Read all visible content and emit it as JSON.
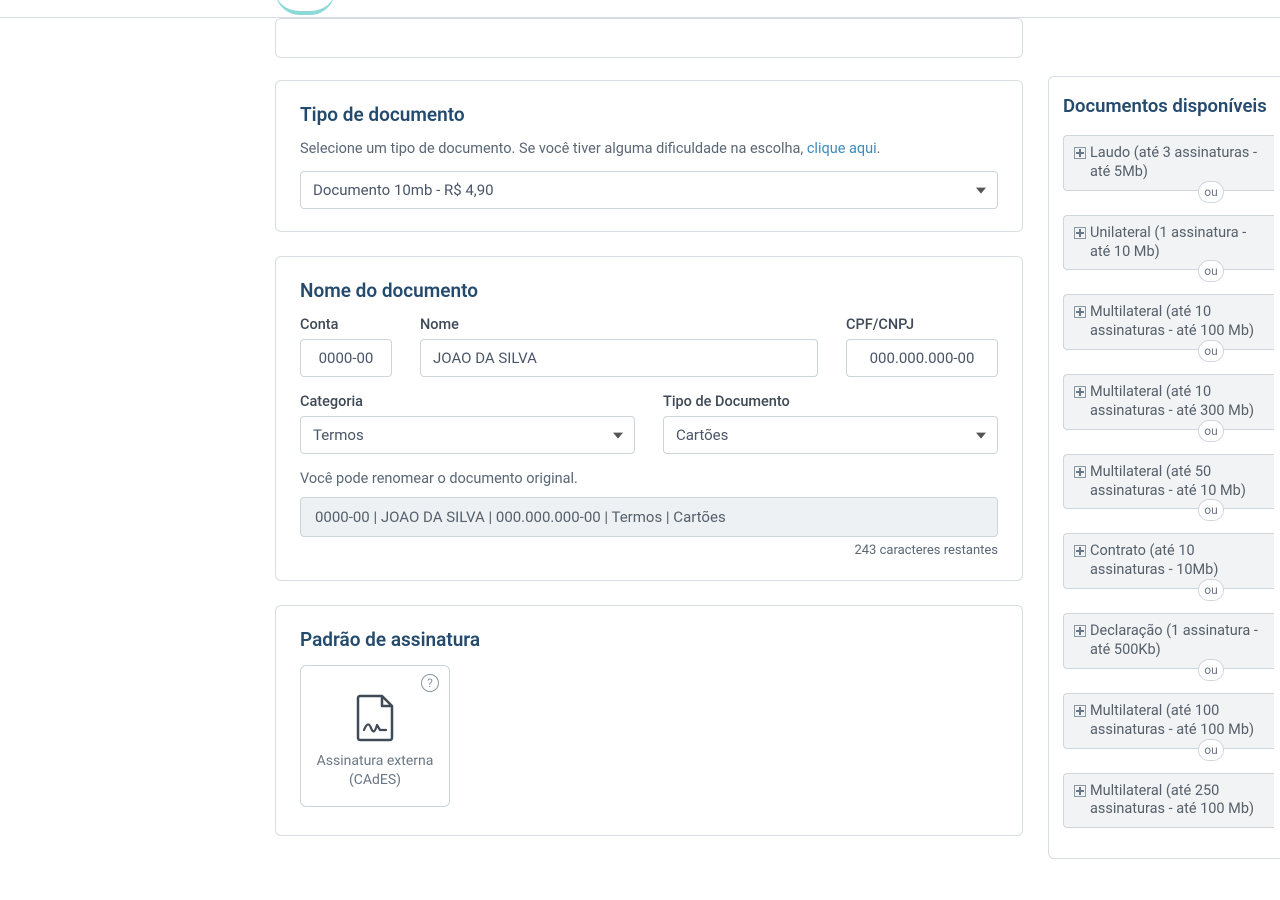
{
  "tipo_documento": {
    "title": "Tipo de documento",
    "helper_prefix": "Selecione um tipo de documento. Se você tiver alguma dificuldade na escolha, ",
    "helper_link": "clique aqui",
    "helper_suffix": ".",
    "selected": "Documento 10mb - R$ 4,90"
  },
  "nome_documento": {
    "title": "Nome do documento",
    "labels": {
      "conta": "Conta",
      "nome": "Nome",
      "cpf": "CPF/CNPJ",
      "categoria": "Categoria",
      "tipo": "Tipo de Documento"
    },
    "values": {
      "conta": "0000-00",
      "nome": "JOAO DA SILVA",
      "cpf": "000.000.000-00",
      "categoria": "Termos",
      "tipo": "Cartões"
    },
    "rename_hint": "Você pode renomear o documento original.",
    "combined": "0000-00 | JOAO DA SILVA  | 000.000.000-00 | Termos | Cartões",
    "char_count": "243 caracteres restantes"
  },
  "padrao_assinatura": {
    "title": "Padrão de assinatura",
    "option_label": "Assinatura externa (CAdES)",
    "help_glyph": "?"
  },
  "sidebar": {
    "title": "Documentos disponíveis",
    "ou_label": "ou",
    "items": [
      {
        "label": "Laudo (até 3 assinaturas - até 5Mb)"
      },
      {
        "label": "Unilateral (1 assinatura - até 10 Mb)"
      },
      {
        "label": "Multilateral (até 10 assinaturas - até 100 Mb)"
      },
      {
        "label": "Multilateral (até 10 assinaturas - até 300 Mb)"
      },
      {
        "label": "Multilateral (até 50 assinaturas - até 10 Mb)"
      },
      {
        "label": "Contrato (até 10 assinaturas - 10Mb)"
      },
      {
        "label": "Declaração (1 assinatura - até 500Kb)"
      },
      {
        "label": "Multilateral (até 100 assinaturas - até 100 Mb)"
      },
      {
        "label": "Multilateral (até 250 assinaturas - até 100 Mb)"
      }
    ]
  }
}
